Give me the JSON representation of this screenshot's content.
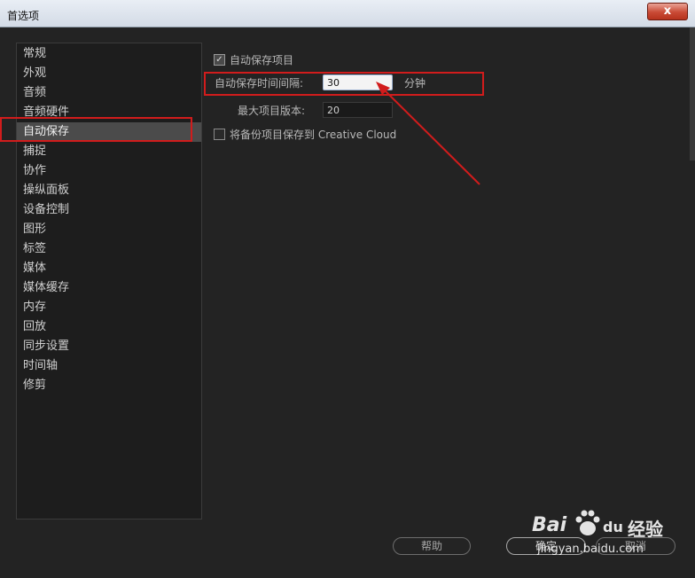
{
  "window": {
    "title": "首选项",
    "close_label": "x"
  },
  "sidebar": {
    "items": [
      {
        "label": "常规"
      },
      {
        "label": "外观"
      },
      {
        "label": "音频"
      },
      {
        "label": "音频硬件"
      },
      {
        "label": "自动保存",
        "selected": true
      },
      {
        "label": "捕捉"
      },
      {
        "label": "协作"
      },
      {
        "label": "操纵面板"
      },
      {
        "label": "设备控制"
      },
      {
        "label": "图形"
      },
      {
        "label": "标签"
      },
      {
        "label": "媒体"
      },
      {
        "label": "媒体缓存"
      },
      {
        "label": "内存"
      },
      {
        "label": "回放"
      },
      {
        "label": "同步设置"
      },
      {
        "label": "时间轴"
      },
      {
        "label": "修剪"
      }
    ]
  },
  "autosave": {
    "enable_label": "自动保存项目",
    "enable_checked": true,
    "interval_label": "自动保存时间间隔:",
    "interval_value": "30",
    "interval_unit": "分钟",
    "max_versions_label": "最大项目版本:",
    "max_versions_value": "20",
    "cloud_label": "将备份项目保存到 Creative Cloud",
    "cloud_checked": false
  },
  "footer": {
    "help_label": "帮助",
    "ok_label": "确定",
    "cancel_label": "取消"
  },
  "watermark": {
    "brand": "Bai",
    "brand_suffix": "du",
    "product": "经验",
    "url": "jingyan.baidu.com"
  },
  "colors": {
    "annotation": "#d11c1c",
    "selected_row": "#4b4b4b"
  }
}
